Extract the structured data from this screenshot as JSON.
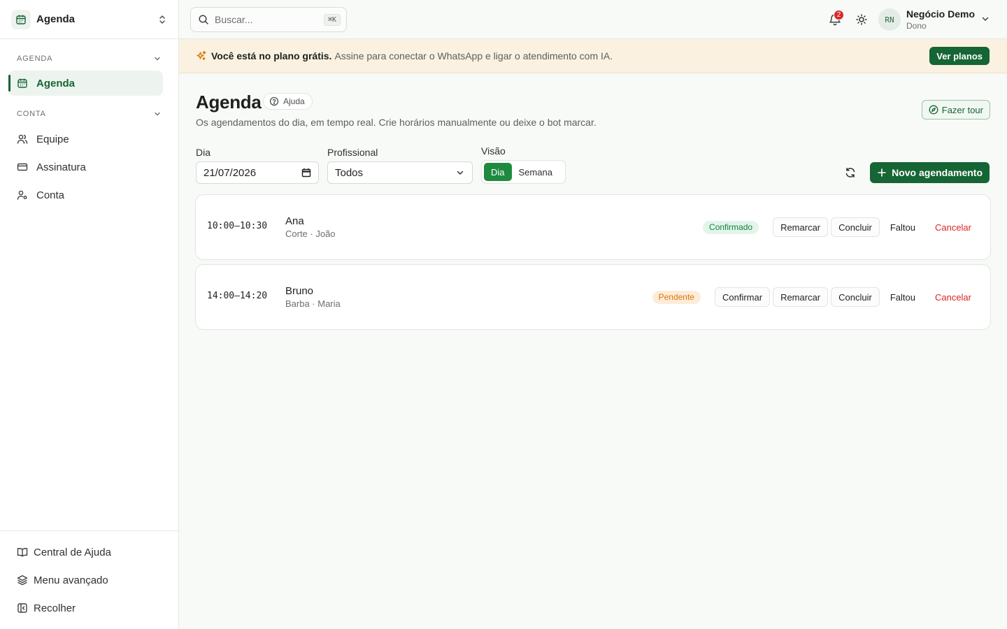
{
  "sidebar": {
    "app_title": "Agenda",
    "sections": [
      {
        "label": "AGENDA",
        "items": [
          {
            "label": "Agenda",
            "icon": "calendar-icon",
            "active": true
          }
        ]
      },
      {
        "label": "CONTA",
        "items": [
          {
            "label": "Equipe",
            "icon": "users-icon"
          },
          {
            "label": "Assinatura",
            "icon": "credit-card-icon"
          },
          {
            "label": "Conta",
            "icon": "user-cog-icon"
          }
        ]
      }
    ],
    "footer": [
      {
        "label": "Central de Ajuda",
        "icon": "book-open-icon"
      },
      {
        "label": "Menu avançado",
        "icon": "layers-icon"
      },
      {
        "label": "Recolher",
        "icon": "panel-left-icon"
      }
    ]
  },
  "topbar": {
    "search_placeholder": "Buscar...",
    "search_shortcut": "⌘K",
    "notifications_count": "2",
    "avatar_initials": "RN",
    "user_name": "Negócio Demo",
    "user_role": "Dono"
  },
  "banner": {
    "bold": "Você está no plano grátis.",
    "text": "Assine para conectar o WhatsApp e ligar o atendimento com IA.",
    "button": "Ver planos"
  },
  "page": {
    "title": "Agenda",
    "help_label": "Ajuda",
    "subtitle": "Os agendamentos do dia, em tempo real. Crie horários manualmente ou deixe o bot marcar.",
    "tour_label": "Fazer tour"
  },
  "filters": {
    "day_label": "Dia",
    "day_value": "21/07/2026",
    "professional_label": "Profissional",
    "professional_value": "Todos",
    "view_label": "Visão",
    "view_options": [
      "Dia",
      "Semana"
    ],
    "view_selected": "Dia",
    "new_button": "Novo agendamento"
  },
  "appointments": [
    {
      "time": "10:00–10:30",
      "client": "Ana",
      "detail": "Corte · João",
      "status": "Confirmado",
      "actions": [
        "Remarcar",
        "Concluir",
        "Faltou",
        "Cancelar"
      ]
    },
    {
      "time": "14:00–14:20",
      "client": "Bruno",
      "detail": "Barba · Maria",
      "status": "Pendente",
      "actions": [
        "Confirmar",
        "Remarcar",
        "Concluir",
        "Faltou",
        "Cancelar"
      ]
    }
  ],
  "colors": {
    "brand": "#166534",
    "accent": "#1f8a3f",
    "danger": "#dc2626",
    "pending": "#d97706",
    "banner_bg": "#faf1e1"
  }
}
